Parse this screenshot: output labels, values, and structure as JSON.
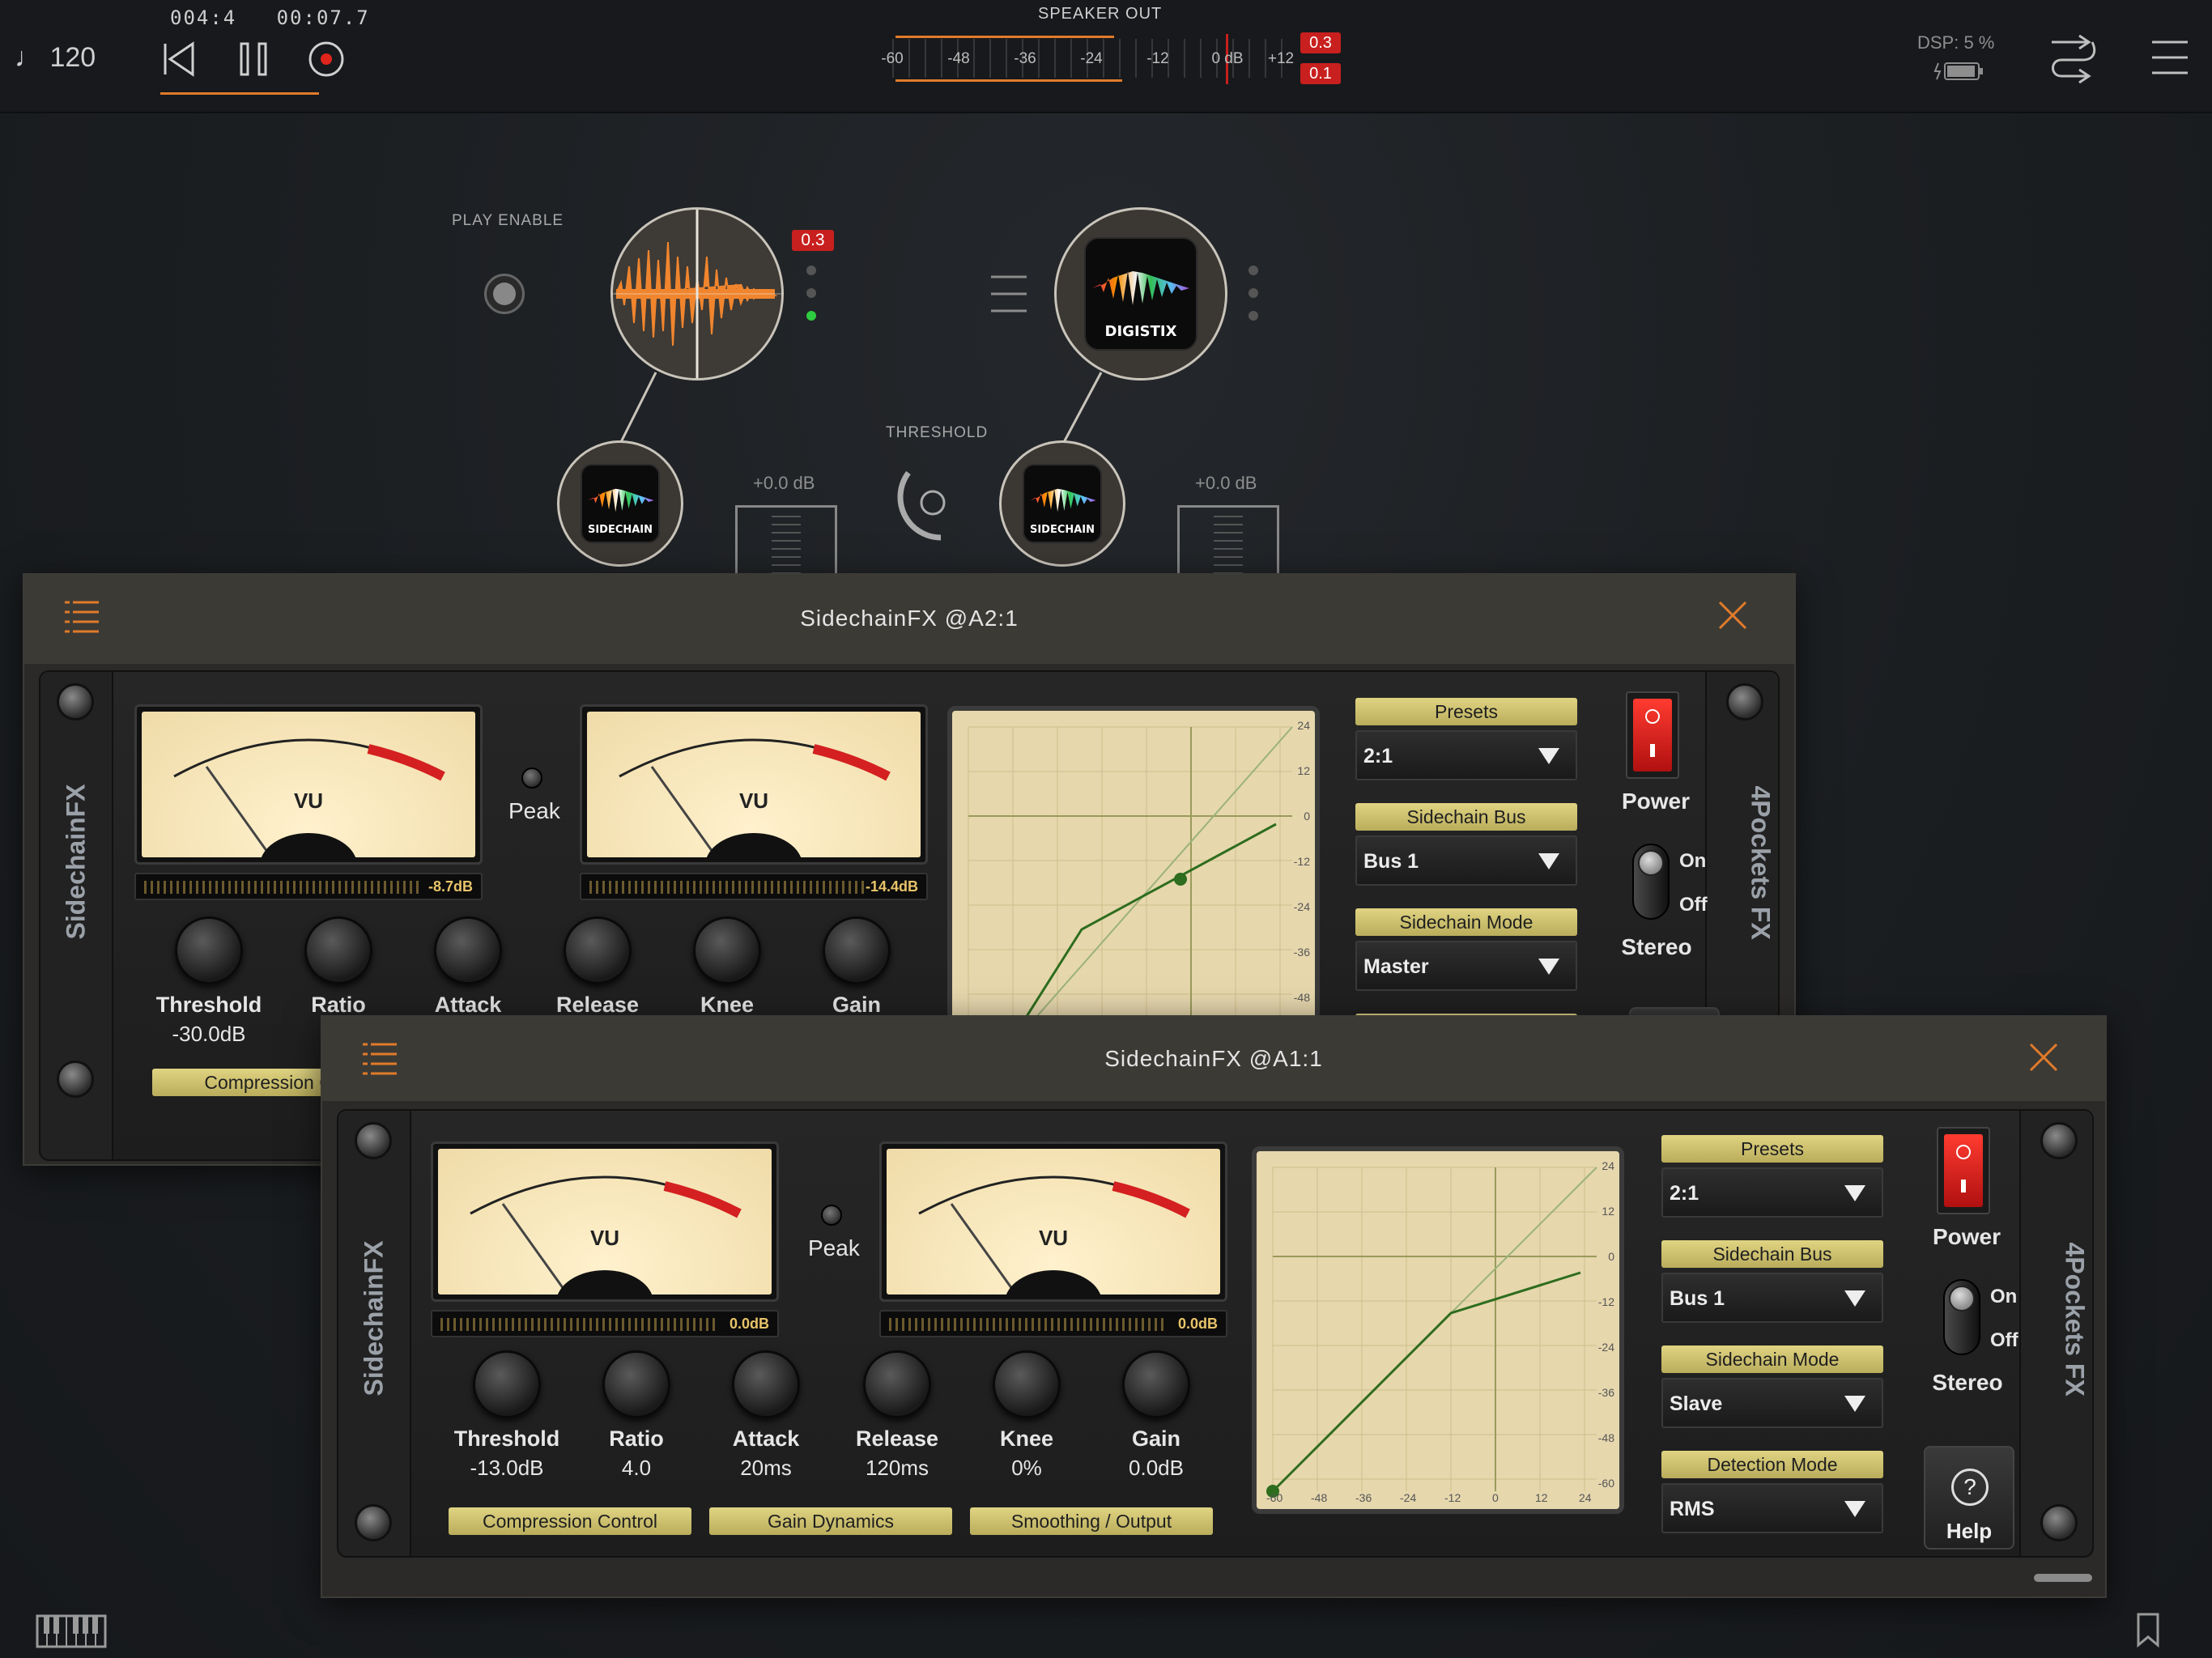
{
  "transport": {
    "tempo": "♩ 120",
    "position_bars": "004:4",
    "position_time": "00:07.7"
  },
  "speaker_out": {
    "title": "SPEAKER OUT",
    "scale": [
      "-60",
      "-48",
      "-36",
      "-24",
      "-12",
      "0 dB",
      "+12"
    ],
    "peak_top": "0.3",
    "peak_bottom": "0.1"
  },
  "dsp": {
    "label": "DSP:  5 %"
  },
  "graph": {
    "play_enable_label": "PLAY ENABLE",
    "input_peak": "0.3",
    "digistix_label": "DIGISTIX",
    "threshold_label": "THRESHOLD",
    "sidechain_a_label": "SIDECHAIN",
    "sidechain_b_label": "SIDECHAIN",
    "fader_a_db": "+0.0 dB",
    "fader_b_db": "+0.0 dB"
  },
  "colors": {
    "accent": "#e07b2a",
    "peak_red": "#c8201e",
    "gold": "#d9cd77",
    "panel": "#3c3a35"
  },
  "win_back": {
    "title": "SidechainFX @A2:1",
    "brand_left": "SidechainFX",
    "brand_right": "4Pockets FX",
    "vu_label": "VU",
    "peak_label": "Peak",
    "bar_in": "-8.7dB",
    "bar_out": "-14.4dB",
    "knobs": [
      {
        "name": "Threshold",
        "value": "-30.0dB"
      },
      {
        "name": "Ratio",
        "value": ""
      },
      {
        "name": "Attack",
        "value": ""
      },
      {
        "name": "Release",
        "value": ""
      },
      {
        "name": "Knee",
        "value": ""
      },
      {
        "name": "Gain",
        "value": ""
      }
    ],
    "section_label": "Compression Co",
    "presets_label": "Presets",
    "preset_value": "2:1",
    "sidechain_bus_label": "Sidechain Bus",
    "sidechain_bus_value": "Bus 1",
    "sidechain_mode_label": "Sidechain Mode",
    "sidechain_mode_value": "Master",
    "power_label": "Power",
    "on_label": "On",
    "off_label": "Off",
    "stereo_label": "Stereo",
    "graph_axis": [
      "24",
      "12",
      "0",
      "-12",
      "-24",
      "-36",
      "-48"
    ]
  },
  "win_front": {
    "title": "SidechainFX @A1:1",
    "brand_left": "SidechainFX",
    "brand_right": "4Pockets FX",
    "vu_label": "VU",
    "peak_label": "Peak",
    "bar_in": "0.0dB",
    "bar_out": "0.0dB",
    "knobs": [
      {
        "name": "Threshold",
        "value": "-13.0dB"
      },
      {
        "name": "Ratio",
        "value": "4.0"
      },
      {
        "name": "Attack",
        "value": "20ms"
      },
      {
        "name": "Release",
        "value": "120ms"
      },
      {
        "name": "Knee",
        "value": "0%"
      },
      {
        "name": "Gain",
        "value": "0.0dB"
      }
    ],
    "sections": [
      "Compression Control",
      "Gain Dynamics",
      "Smoothing / Output"
    ],
    "presets_label": "Presets",
    "preset_value": "2:1",
    "sidechain_bus_label": "Sidechain Bus",
    "sidechain_bus_value": "Bus 1",
    "sidechain_mode_label": "Sidechain Mode",
    "sidechain_mode_value": "Slave",
    "detection_mode_label": "Detection Mode",
    "detection_mode_value": "RMS",
    "power_label": "Power",
    "on_label": "On",
    "off_label": "Off",
    "stereo_label": "Stereo",
    "help_label": "Help",
    "graph_axis_y": [
      "24",
      "12",
      "0",
      "-12",
      "-24",
      "-36",
      "-48",
      "-60"
    ],
    "graph_axis_x": [
      "-60",
      "-48",
      "-36",
      "-24",
      "-12",
      "0",
      "12",
      "24"
    ]
  }
}
